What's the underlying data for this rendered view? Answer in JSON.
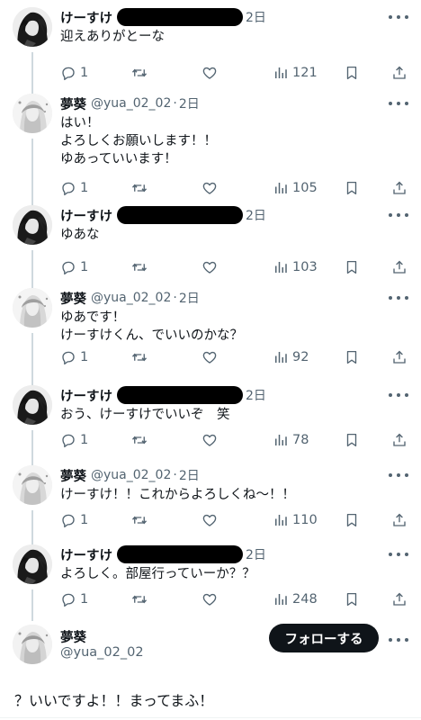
{
  "replies": [
    {
      "name": "けーすけ",
      "handle": "",
      "redacted": true,
      "redact_width": 140,
      "time": "2日",
      "text": "迎えありがとーな",
      "stats": {
        "reply": "1",
        "retweet": "",
        "like": "",
        "views": "121"
      },
      "avatar": "dark"
    },
    {
      "name": "夢葵",
      "handle": "@yua_02_02",
      "redacted": false,
      "time": "2日",
      "text": "はい！\nよろしくお願いします！！\nゆあっていいます！",
      "stats": {
        "reply": "1",
        "retweet": "",
        "like": "",
        "views": "105"
      },
      "avatar": "light"
    },
    {
      "name": "けーすけ",
      "handle": "",
      "redacted": true,
      "redact_width": 140,
      "time": "2日",
      "text": "ゆあな",
      "stats": {
        "reply": "1",
        "retweet": "",
        "like": "",
        "views": "103"
      },
      "avatar": "dark"
    },
    {
      "name": "夢葵",
      "handle": "@yua_02_02",
      "redacted": false,
      "time": "2日",
      "text": "ゆあです！\nけーすけくん、でいいのかな？",
      "stats": {
        "reply": "1",
        "retweet": "",
        "like": "",
        "views": "92"
      },
      "avatar": "light"
    },
    {
      "name": "けーすけ",
      "handle": "",
      "redacted": true,
      "redact_width": 140,
      "time": "2日",
      "text": "おう、けーすけでいいぞ　笑",
      "stats": {
        "reply": "1",
        "retweet": "",
        "like": "",
        "views": "78"
      },
      "avatar": "dark"
    },
    {
      "name": "夢葵",
      "handle": "@yua_02_02",
      "redacted": false,
      "time": "2日",
      "text": "けーすけ！！これからよろしくね〜！！",
      "stats": {
        "reply": "1",
        "retweet": "",
        "like": "",
        "views": "110"
      },
      "avatar": "light"
    },
    {
      "name": "けーすけ",
      "handle": "",
      "redacted": true,
      "redact_width": 140,
      "time": "2日",
      "text": "よろしく。部屋行っていーか？？",
      "stats": {
        "reply": "1",
        "retweet": "",
        "like": "",
        "views": "248"
      },
      "avatar": "dark"
    }
  ],
  "main_tweet": {
    "name": "夢葵",
    "handle": "@yua_02_02",
    "follow_label": "フォローする",
    "text": "？いいですよ！！まってまふ！"
  },
  "icons": {
    "reply": "reply-icon",
    "retweet": "retweet-icon",
    "like": "heart-icon",
    "views": "views-icon",
    "bookmark": "bookmark-icon",
    "share": "share-icon",
    "more": "more-icon"
  },
  "colors": {
    "text": "#0f1419",
    "muted": "#536471",
    "thread_line": "#cfd9de",
    "button": "#0f1419"
  }
}
